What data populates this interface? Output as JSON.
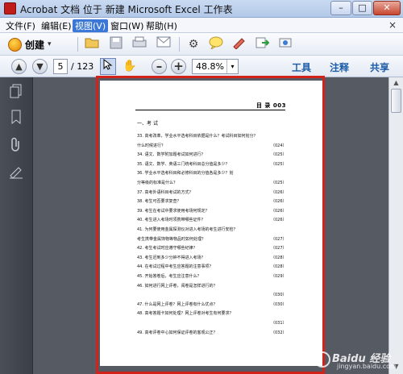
{
  "window": {
    "title": "Acrobat 文档 位于 新建 Microsoft Excel 工作表",
    "min_glyph": "–",
    "max_glyph": "□",
    "close_glyph": "✕"
  },
  "menu": {
    "items": [
      {
        "label": "文件(F)"
      },
      {
        "label": "编辑(E)"
      },
      {
        "label": "视图(V)"
      },
      {
        "label": "窗口(W)"
      },
      {
        "label": "帮助(H)"
      }
    ],
    "active_index": 2,
    "close_glyph": "×"
  },
  "toolbar1": {
    "create_label": "创建",
    "caret": "▾",
    "icons": [
      "folder-icon",
      "save-icon",
      "email-icon",
      "gear-icon",
      "comment-icon",
      "sign-icon",
      "export-icon",
      "share-icon"
    ]
  },
  "toolbar2": {
    "page_current": "5",
    "page_total": "/ 123",
    "zoom_value": "48.8%",
    "zoom_caret": "▾",
    "tools_label": "工具",
    "comments_label": "注释",
    "share_label": "共享"
  },
  "document": {
    "header": "目 录 003",
    "section_title": "一、考 试",
    "entries": [
      {
        "text": "33. 高考改革，学业水平选考科目依据是什么？考试科目如何划分？",
        "page": ""
      },
      {
        "text": "    什么时候进行？",
        "page": "（024）"
      },
      {
        "text": "34. 语文、数学附加题考试如何进行？",
        "page": "（025）"
      },
      {
        "text": "35. 语文、数学、英语三门统考科目总分值是多少？",
        "page": "（025）"
      },
      {
        "text": "36. 学业水平选考科目和必修科目的分值各是多少？划",
        "page": ""
      },
      {
        "text": "    分等级的标准是什么？",
        "page": "（025）"
      },
      {
        "text": "37. 高考外语科目考试的方式？",
        "page": "（026）"
      },
      {
        "text": "38. 考生可否要求复查？",
        "page": "（026）"
      },
      {
        "text": "39. 考生在考试中要求使用考场何规定？",
        "page": "（026）"
      },
      {
        "text": "40. 考生进入考场时须携带哪些证件？",
        "page": "（026）"
      },
      {
        "text": "41. 为何要使用金属探测仪对进入考场的考生进行安检？",
        "page": ""
      },
      {
        "text": "    考生携带金属饰物等物品时如何处理？",
        "page": "（027）"
      },
      {
        "text": "42. 考生考试时应遵守哪些纪律？",
        "page": "（027）"
      },
      {
        "text": "43. 考生迟到多少分钟不得进入考场？",
        "page": "（028）"
      },
      {
        "text": "44. 在考试过程中考生应答题的注意事项？",
        "page": "（028）"
      },
      {
        "text": "45. 开始答卷后，考生应注意什么？",
        "page": "（029）"
      },
      {
        "text": "46. 如何进行网上评卷，阅卷是怎样进行的？",
        "page": ""
      },
      {
        "text": "",
        "page": "（030）"
      },
      {
        "text": "47. 什么是网上评卷？网上评卷有什么优点？",
        "page": "（030）"
      },
      {
        "text": "48. 高考答题卡如何处理？网上评卷对考生有何要求？",
        "page": ""
      },
      {
        "text": "",
        "page": "（031）"
      },
      {
        "text": "49. 高考评卷中心如何保证评卷的客观公正？",
        "page": "（032）"
      }
    ]
  },
  "watermark": {
    "line1": "Baidu 经验",
    "line2": "jingyan.baidu.com"
  }
}
